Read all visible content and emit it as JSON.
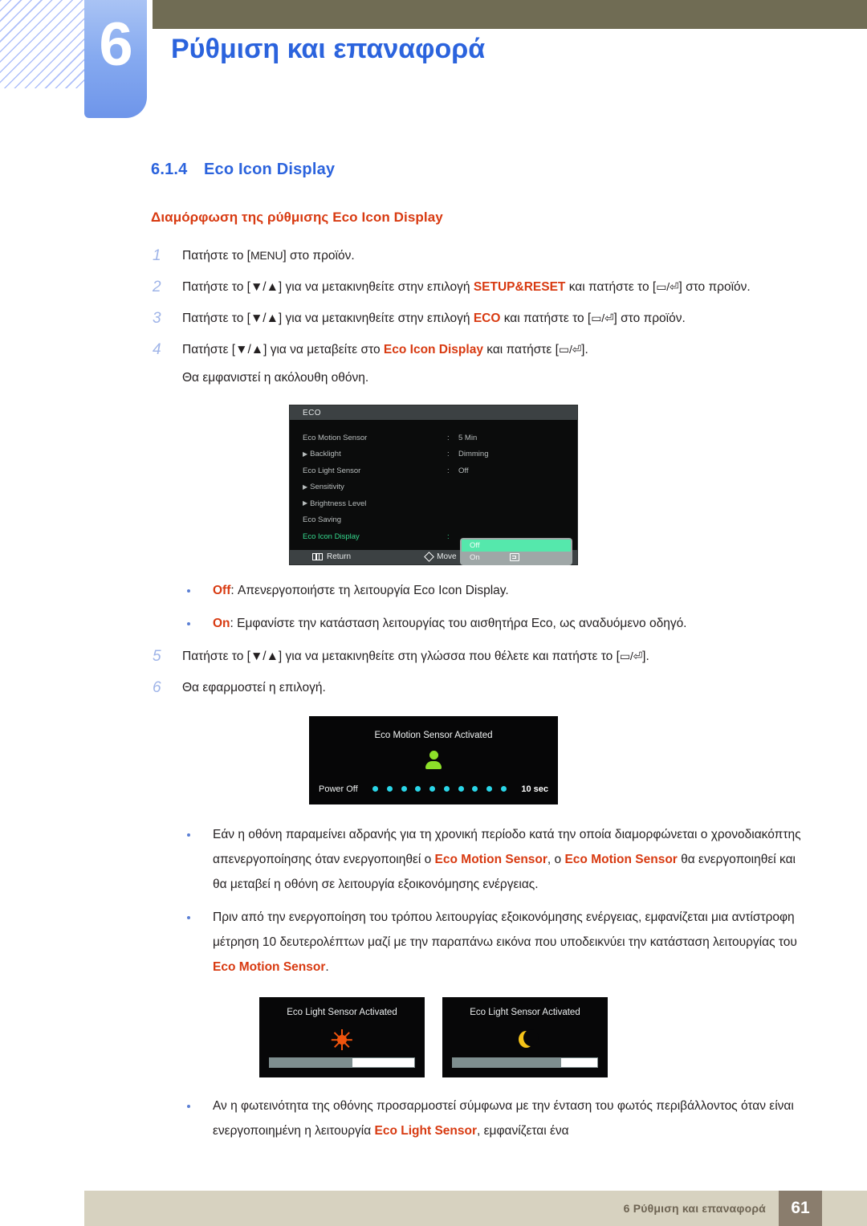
{
  "header": {
    "chapter_number": "6",
    "chapter_title": "Ρύθμιση και επαναφορά"
  },
  "section": {
    "number": "6.1.4",
    "title": "Eco Icon Display",
    "subheading": "Διαμόρφωση της ρύθμισης Eco Icon Display"
  },
  "steps": [
    {
      "num": "1",
      "pre": "Πατήστε το [",
      "key": "MENU",
      "post": "] στο προϊόν."
    },
    {
      "num": "2",
      "a": "Πατήστε το [▼/▲] για να μετακινηθείτε στην επιλογή ",
      "kw": "SETUP&RESET",
      "b": " και πατήστε το [",
      "keys": "▭/⏎",
      "c": "] στο προϊόν."
    },
    {
      "num": "3",
      "a": "Πατήστε το [▼/▲] για να μετακινηθείτε στην επιλογή ",
      "kw": "ECO",
      "b": " και πατήστε το [",
      "keys": "▭/⏎",
      "c": "] στο προϊόν."
    },
    {
      "num": "4",
      "a": "Πατήστε [▼/▲] για να μεταβείτε στο ",
      "kw": "Eco Icon Display",
      "b": " και πατήστε [",
      "keys": "▭/⏎",
      "c": "].",
      "sub": "Θα εμφανιστεί η ακόλουθη οθόνη."
    },
    {
      "num": "5",
      "a": "Πατήστε το [▼/▲] για να μετακινηθείτε στη γλώσσα που θέλετε και πατήστε το [",
      "keys": "▭/⏎",
      "c": "]."
    },
    {
      "num": "6",
      "a": "Θα εφαρμοστεί η επιλογή."
    }
  ],
  "osd": {
    "title": "ECO",
    "rows": [
      {
        "label": "Eco Motion Sensor",
        "arrow": false,
        "colon": ":",
        "value": "5 Min"
      },
      {
        "label": "Backlight",
        "arrow": true,
        "colon": ":",
        "value": "Dimming"
      },
      {
        "label": "Eco Light Sensor",
        "arrow": false,
        "colon": ":",
        "value": "Off"
      },
      {
        "label": "Sensitivity",
        "arrow": true,
        "colon": "",
        "value": ""
      },
      {
        "label": "Brightness Level",
        "arrow": true,
        "colon": "",
        "value": ""
      },
      {
        "label": "Eco Saving",
        "arrow": false,
        "colon": "",
        "value": ""
      },
      {
        "label": "Eco Icon Display",
        "arrow": false,
        "colon": ":",
        "value": "",
        "selected": true
      }
    ],
    "dropdown": {
      "options": [
        "Off",
        "On"
      ],
      "selected": "Off",
      "highlight_color": "#55e8ac",
      "background_color": "#9fa7a7"
    },
    "footer": [
      {
        "icon": "return-icon",
        "label": "Return"
      },
      {
        "icon": "move-icon",
        "label": "Move"
      },
      {
        "icon": "enter-icon",
        "label": "Enter"
      }
    ]
  },
  "option_bullets": [
    {
      "kw": "Off",
      "text": ": Απενεργοποιήστε τη λειτουργία Eco Icon Display."
    },
    {
      "kw": "On",
      "text": ": Εμφανίστε την κατάσταση λειτουργίας του αισθητήρα Eco, ως αναδυόμενο οδηγό."
    }
  ],
  "motion_panel": {
    "title": "Eco Motion Sensor Activated",
    "power_label": "Power Off",
    "seconds": "10 sec",
    "dot_count": 10,
    "dot_color": "#2ad6e8",
    "person_color": "#8ddf29"
  },
  "notes": [
    {
      "a": "Εάν η οθόνη παραμείνει αδρανής για τη χρονική περίοδο κατά την οποία διαμορφώνεται ο χρονοδιακόπτης απενεργοποίησης όταν ενεργοποιηθεί ο ",
      "kw1": "Eco Motion Sensor",
      "b": ", ο ",
      "kw2": "Eco Motion Sensor",
      "c": " θα ενεργοποιηθεί και θα μεταβεί η οθόνη σε λειτουργία εξοικονόμησης ενέργειας."
    },
    {
      "a": "Πριν από την ενεργοποίηση του τρόπου λειτουργίας εξοικονόμησης ενέργειας, εμφανίζεται μια αντίστροφη μέτρηση 10 δευτερολέπτων μαζί με την παραπάνω εικόνα που υποδεικνύει την κατάσταση λειτουργίας του ",
      "kw1": "Eco Motion Sensor",
      "c": "."
    }
  ],
  "light_panels": [
    {
      "title": "Eco Light Sensor Activated",
      "icon": "sun-icon",
      "fill_percent": 57,
      "icon_color": "#f0540d"
    },
    {
      "title": "Eco Light Sensor Activated",
      "icon": "moon-icon",
      "fill_percent": 75,
      "icon_color": "#f5c318"
    }
  ],
  "final_note": {
    "a": "Αν η φωτεινότητα της οθόνης προσαρμοστεί σύμφωνα με την ένταση του φωτός περιβάλλοντος όταν είναι ενεργοποιημένη η λειτουργία ",
    "kw1": "Eco Light Sensor",
    "c": ", εμφανίζεται ένα"
  },
  "footer": {
    "text": "6 Ρύθμιση και επαναφορά",
    "page": "61"
  }
}
